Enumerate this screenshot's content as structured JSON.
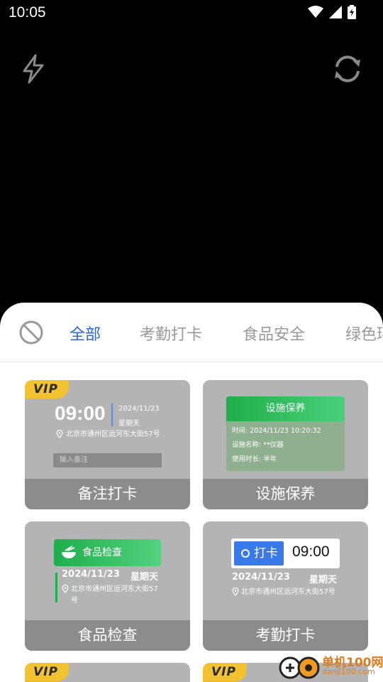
{
  "status_bar": {
    "time": "10:05"
  },
  "camera": {
    "flash_icon": "flash-off-icon",
    "switch_icon": "camera-switch-icon"
  },
  "tabs": [
    {
      "label": "全部",
      "active": true
    },
    {
      "label": "考勤打卡",
      "active": false
    },
    {
      "label": "食品安全",
      "active": false
    },
    {
      "label": "绿色环",
      "active": false
    }
  ],
  "cards": {
    "note_checkin": {
      "badge": "VIP",
      "time": "09:00",
      "date": "2024/11/23",
      "weekday": "星期天",
      "address": "北京市通州区运河东大街57号",
      "input_placeholder": "输入备注",
      "caption": "备注打卡"
    },
    "facility": {
      "header": "设施保养",
      "line1": "时间: 2024/11/23   10:20:32",
      "line2": "设施名称: **仪器",
      "line3": "使用时长: 半年",
      "caption": "设施保养"
    },
    "food": {
      "header": "食品检查",
      "date": "2024/11/23",
      "weekday": "星期天",
      "address": "北京市通州区运河东大街57号",
      "caption": "食品检查"
    },
    "attendance": {
      "button": "打卡",
      "time": "09:00",
      "date": "2024/11/23",
      "weekday": "星期天",
      "address": "北京市通州区运河东大街57号",
      "caption": "考勤打卡"
    },
    "partial_left": {
      "badge": "VIP"
    },
    "partial_right": {
      "badge": "VIP"
    }
  },
  "watermark": {
    "title": "单机100网",
    "url": "danji100.com"
  },
  "colors": {
    "accent": "#2f64d8",
    "vip": "#f2c230",
    "green": "#1fae4b",
    "blue": "#3979e8"
  }
}
